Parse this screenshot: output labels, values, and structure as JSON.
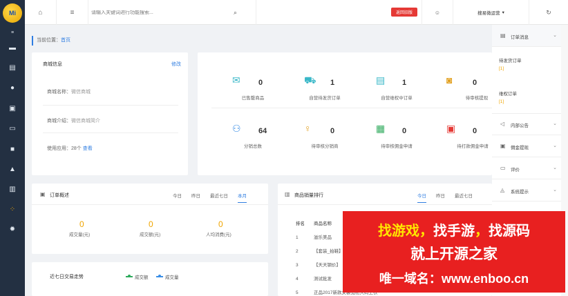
{
  "logo": {
    "text": "Mi"
  },
  "sidebar": {
    "items": [
      {
        "icon": "menu-icon",
        "glyph": "≡"
      },
      {
        "icon": "card-icon",
        "glyph": "▬"
      },
      {
        "icon": "document-icon",
        "glyph": "▤"
      },
      {
        "icon": "user-icon",
        "glyph": "●"
      },
      {
        "icon": "file-icon",
        "glyph": "▣"
      },
      {
        "icon": "wallet-icon",
        "glyph": "▭"
      },
      {
        "icon": "gift-icon",
        "glyph": "■"
      },
      {
        "icon": "bell-icon",
        "glyph": "▲"
      },
      {
        "icon": "chart-icon",
        "glyph": "▥"
      },
      {
        "icon": "apps-icon",
        "glyph": "⁘"
      },
      {
        "icon": "gear-icon",
        "glyph": "✹"
      }
    ]
  },
  "topbar": {
    "home_glyph": "⌂",
    "menu_glyph": "≡",
    "search_placeholder": "请输入关键词进行功能搜索...",
    "search_glyph": "⌕",
    "back_label": "返回旧版",
    "face_glyph": "☺",
    "user_label": "搜易微运营",
    "user_caret": "▾",
    "refresh_glyph": "↻"
  },
  "breadcrumb": {
    "prefix": "当前位置：",
    "link": "首页"
  },
  "shop": {
    "title": "商城信息",
    "edit": "修改",
    "name_label": "商城名称：",
    "name_value": "微信商城",
    "intro_label": "商城介绍：",
    "intro_value": "微信商城简介",
    "apps_label": "使用应用：",
    "apps_value": "28个",
    "apps_link": "查看"
  },
  "stats": [
    {
      "icon": "envelope-icon",
      "glyph": "✉",
      "num": "0",
      "label": "已售罄商品"
    },
    {
      "icon": "truck-icon",
      "glyph": "⛟",
      "num": "1",
      "label": "自营待发货订单"
    },
    {
      "icon": "receipt-icon",
      "glyph": "▤",
      "num": "1",
      "label": "自营维权中订单"
    },
    {
      "icon": "search-doc-icon",
      "glyph": "◙",
      "num": "0",
      "label": "待审核提现"
    },
    {
      "icon": "group-icon",
      "glyph": "⚇",
      "num": "64",
      "label": "分销总数"
    },
    {
      "icon": "person-icon",
      "glyph": "♀",
      "num": "0",
      "label": "待审核分销商"
    },
    {
      "icon": "money-doc-icon",
      "glyph": "▦",
      "num": "0",
      "label": "待审核佣金申请"
    },
    {
      "icon": "print-icon",
      "glyph": "▣",
      "num": "0",
      "label": "待打款佣金申请"
    }
  ],
  "orders": {
    "title": "订单概述",
    "tabs": [
      "今日",
      "昨日",
      "最近七日",
      "本月"
    ],
    "active_tab": 3,
    "metrics": [
      {
        "num": "0",
        "label": "成交量(元)"
      },
      {
        "num": "0",
        "label": "成交额(元)"
      },
      {
        "num": "0",
        "label": "人均消费(元)"
      }
    ]
  },
  "trend": {
    "title": "近七日交易走势",
    "legend": [
      {
        "name": "成交额",
        "color": "#2eaa5c"
      },
      {
        "name": "成交量",
        "color": "#3a8ee6"
      }
    ]
  },
  "ranking": {
    "title": "商品销量排行",
    "tabs": [
      "今日",
      "昨日",
      "最近七日"
    ],
    "active_tab": 0,
    "col_rank": "排名",
    "col_name": "商品名称",
    "rows": [
      {
        "rank": "1",
        "name": "滋乐美品"
      },
      {
        "rank": "2",
        "name": "【套装_拍鞋】"
      },
      {
        "rank": "3",
        "name": "【天天钢价】"
      },
      {
        "rank": "4",
        "name": "测试批发"
      },
      {
        "rank": "5",
        "name": "正品2017新款女装宽松大码上衣"
      }
    ]
  },
  "rightpanel": {
    "order_msg": "订单消息",
    "pending_ship": "待发货订单",
    "pending_ship_count": "[1]",
    "rights": "维权订单",
    "rights_count": "[1]",
    "notice": "内部公告",
    "commission": "佣金提现",
    "review": "评价",
    "system": "系统提示"
  },
  "ad": {
    "line1_a": "找游戏",
    "line1_sep1": "，",
    "line1_b": "找手游",
    "line1_sep2": "，",
    "line1_c": "找源码",
    "line2": "就上开源之家",
    "line3": "唯一域名：www.enboo.cn"
  }
}
